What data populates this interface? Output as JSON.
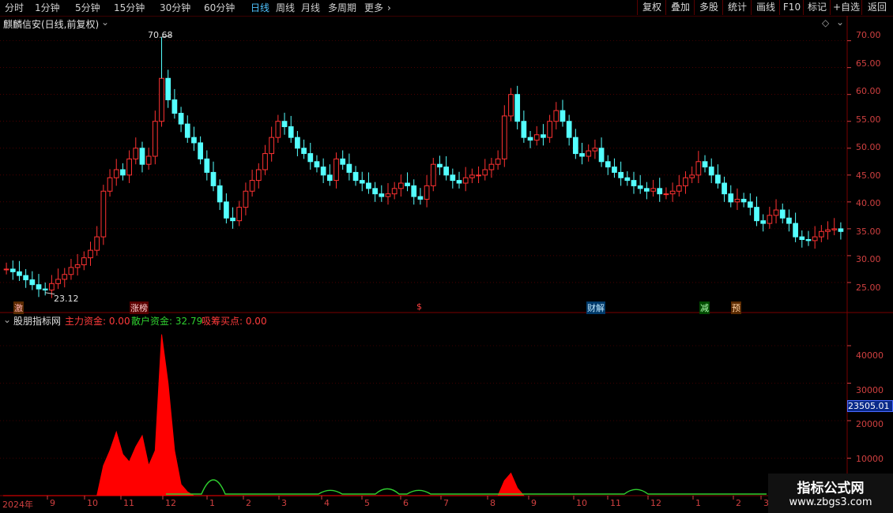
{
  "toolbar": {
    "periods": [
      "分时",
      "1分钟",
      "5分钟",
      "15分钟",
      "30分钟",
      "60分钟",
      "日线",
      "周线",
      "月线",
      "多周期",
      "更多"
    ],
    "active_period": "日线",
    "buttons": [
      "复权",
      "叠加",
      "多股",
      "统计",
      "画线",
      "F10",
      "标记",
      "+自选",
      "返回"
    ]
  },
  "stock_title": "麒麟信安(日线,前复权)",
  "price_axis": {
    "labels": [
      "70.00",
      "65.00",
      "60.00",
      "55.00",
      "50.00",
      "45.00",
      "40.00",
      "35.00",
      "30.00",
      "25.00"
    ]
  },
  "price_annotations": {
    "high": "70.68",
    "low": "23.12"
  },
  "event_tags": [
    "激",
    "涨榜",
    "$",
    "财解",
    "减",
    "预"
  ],
  "indicator": {
    "name": "股朋指标网",
    "main_fund": "主力资金: 0.00",
    "retail_fund": "散户资金: 32.79",
    "accumulate": "吸筹买点: 0.00",
    "axis_labels": [
      "40000",
      "30000",
      "20000",
      "10000"
    ],
    "cursor_value": "23505.01"
  },
  "x_axis": {
    "labels": [
      "2024年",
      "9",
      "10",
      "11",
      "12",
      "1",
      "2",
      "3",
      "4",
      "5",
      "6",
      "7",
      "8",
      "9",
      "10",
      "11",
      "12",
      "1",
      "2",
      "3"
    ]
  },
  "watermark": {
    "line1": "指标公式网",
    "line2": "www.zbgs3.com"
  },
  "colors": {
    "up": "#ff3232",
    "down": "#54ffff",
    "main_fund": "#ff0000",
    "retail_fund": "#2fd02f",
    "grid": "#7a0000"
  },
  "chart_data": {
    "type": "candlestick",
    "title": "麒麟信安(日线,前复权)",
    "ylim": [
      20,
      72
    ],
    "y_ticks": [
      25,
      30,
      35,
      40,
      45,
      50,
      55,
      60,
      65,
      70
    ],
    "high_point": 70.68,
    "low_point": 23.12,
    "close_series": [
      27.5,
      27.0,
      26.3,
      25.5,
      24.6,
      23.8,
      23.6,
      24.8,
      25.6,
      26.5,
      27.8,
      28.3,
      29.6,
      31.0,
      33.5,
      42.0,
      44.5,
      46.0,
      45.0,
      48.0,
      50.0,
      47.0,
      48.5,
      55.0,
      63.0,
      59.0,
      56.5,
      54.5,
      52.0,
      51.0,
      48.0,
      45.5,
      43.0,
      40.0,
      37.0,
      36.5,
      39.0,
      42.0,
      44.0,
      46.0,
      49.0,
      52.0,
      55.0,
      54.0,
      52.0,
      50.0,
      49.0,
      47.5,
      46.5,
      45.0,
      44.0,
      48.0,
      47.0,
      45.5,
      44.0,
      43.5,
      42.5,
      41.5,
      41.0,
      41.5,
      42.5,
      43.5,
      43.0,
      41.0,
      40.5,
      43.0,
      47.0,
      46.5,
      45.0,
      44.0,
      43.5,
      44.5,
      45.0,
      45.0,
      46.0,
      47.0,
      48.0,
      56.0,
      60.0,
      55.0,
      52.0,
      51.5,
      52.5,
      52.0,
      55.0,
      57.0,
      55.0,
      52.0,
      49.0,
      48.5,
      49.5,
      50.0,
      47.5,
      46.5,
      45.5,
      44.5,
      44.0,
      43.0,
      42.5,
      42.0,
      42.5,
      41.5,
      41.5,
      42.0,
      43.0,
      44.5,
      45.0,
      47.5,
      46.5,
      45.0,
      43.5,
      41.5,
      40.0,
      40.5,
      40.0,
      39.0,
      36.5,
      36.0,
      37.5,
      38.5,
      37.0,
      36.0,
      33.5,
      33.0,
      32.8,
      33.5,
      34.5,
      34.8,
      35.0,
      34.5
    ],
    "volume_series": {
      "main": [
        0,
        0,
        0,
        0,
        0,
        0,
        0,
        0,
        0,
        0,
        0,
        0,
        0,
        0,
        0,
        8000,
        12000,
        17000,
        11000,
        9000,
        13000,
        16000,
        8000,
        12000,
        43000,
        30000,
        12000,
        3000,
        1000,
        0,
        0,
        0,
        0,
        0,
        0,
        0,
        0,
        0,
        0,
        0,
        0,
        0,
        0,
        0,
        0,
        0,
        0,
        0,
        0,
        0,
        0,
        0,
        0,
        0,
        0,
        0,
        0,
        0,
        0,
        0,
        0,
        0,
        0,
        0,
        0,
        0,
        0,
        0,
        0,
        0,
        0,
        0,
        0,
        0,
        0,
        0,
        0,
        4000,
        6000,
        2000,
        0
      ],
      "retail_peaks": [
        5000,
        1500,
        2000,
        1500,
        1800
      ]
    }
  }
}
